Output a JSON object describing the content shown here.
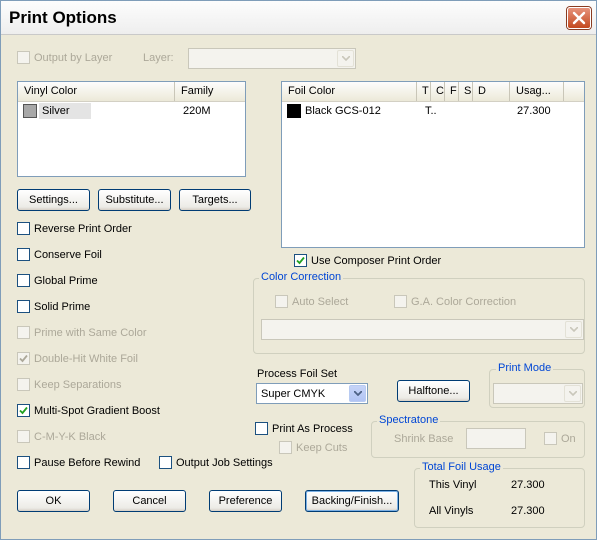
{
  "window": {
    "title": "Print Options"
  },
  "top": {
    "output_by_layer": "Output by Layer",
    "layer_label": "Layer:",
    "layer_value": ""
  },
  "vinyl_table": {
    "columns": [
      "Vinyl Color",
      "Family"
    ],
    "rows": [
      {
        "color_name": "Silver",
        "swatch": "#a8a8a8",
        "family": "220M"
      }
    ]
  },
  "foil_table": {
    "columns": [
      "Foil Color",
      "T",
      "C",
      "F",
      "S",
      "D",
      "Usag..."
    ],
    "rows": [
      {
        "color_name": "Black GCS-012",
        "swatch": "#000000",
        "t": "T..",
        "usage": "27.300"
      }
    ]
  },
  "buttons": {
    "settings": "Settings...",
    "substitute": "Substitute...",
    "targets": "Targets...",
    "halftone": "Halftone...",
    "ok": "OK",
    "cancel": "Cancel",
    "preference": "Preference",
    "backing_finish": "Backing/Finish..."
  },
  "options": {
    "reverse_print_order": {
      "label": "Reverse Print Order",
      "checked": false,
      "enabled": true
    },
    "conserve_foil": {
      "label": "Conserve Foil",
      "checked": false,
      "enabled": true
    },
    "global_prime": {
      "label": "Global Prime",
      "checked": false,
      "enabled": true
    },
    "solid_prime": {
      "label": "Solid Prime",
      "checked": false,
      "enabled": true
    },
    "prime_same_color": {
      "label": "Prime with Same Color",
      "checked": false,
      "enabled": false
    },
    "double_hit_white_foil": {
      "label": "Double-Hit White Foil",
      "checked": true,
      "enabled": false
    },
    "keep_separations": {
      "label": "Keep Separations",
      "checked": false,
      "enabled": false
    },
    "multi_spot_gradient_boost": {
      "label": "Multi-Spot Gradient Boost",
      "checked": true,
      "enabled": true
    },
    "cmyk_black": {
      "label": "C-M-Y-K Black",
      "checked": false,
      "enabled": false
    },
    "pause_before_rewind": {
      "label": "Pause Before Rewind",
      "checked": false,
      "enabled": true
    },
    "output_job_settings": {
      "label": "Output Job Settings",
      "checked": false,
      "enabled": true
    }
  },
  "composer": {
    "label": "Use Composer Print Order",
    "checked": true
  },
  "color_correction": {
    "title": "Color Correction",
    "auto_select": "Auto Select",
    "ga_color_correction": "G.A. Color Correction"
  },
  "process_foil": {
    "label": "Process Foil Set",
    "value": "Super CMYK",
    "print_as_process": "Print As Process",
    "keep_cuts": "Keep Cuts"
  },
  "print_mode": {
    "title": "Print Mode",
    "value": ""
  },
  "spectratone": {
    "title": "Spectratone",
    "shrink_base": "Shrink Base",
    "on": "On"
  },
  "total_foil_usage": {
    "title": "Total Foil Usage",
    "this_vinyl_label": "This Vinyl",
    "this_vinyl_value": "27.300",
    "all_vinyls_label": "All Vinyls",
    "all_vinyls_value": "27.300"
  }
}
